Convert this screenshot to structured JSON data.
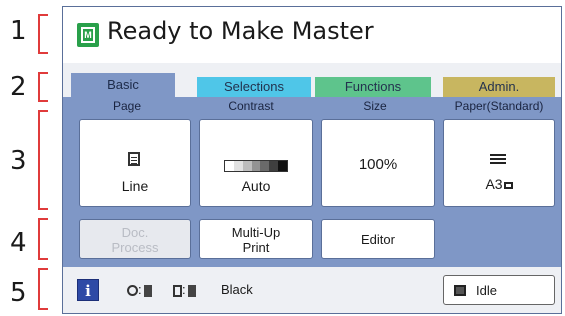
{
  "callouts": [
    "1",
    "2",
    "3",
    "4",
    "5"
  ],
  "title": {
    "icon": "master-document-icon",
    "icon_glyph": "M",
    "text": "Ready to Make Master"
  },
  "tabs": [
    {
      "label": "Basic",
      "color": "#7f97c6",
      "selected": true
    },
    {
      "label": "Selections",
      "color": "#4fc6e8"
    },
    {
      "label": "Functions",
      "color": "#5ec48c"
    },
    {
      "label": "Admin.",
      "color": "#c8b660"
    }
  ],
  "functions": [
    {
      "label": "Page",
      "value": "Line",
      "icon": "document-lines-icon"
    },
    {
      "label": "Contrast",
      "value": "Auto",
      "icon": "grayscale-bar-icon"
    },
    {
      "label": "Size",
      "value": "100%"
    },
    {
      "label": "Paper(Standard)",
      "value": "A3",
      "icon": "paper-stack-icon"
    }
  ],
  "secondary_buttons": [
    {
      "label_line1": "Doc.",
      "label_line2": "Process",
      "enabled": false
    },
    {
      "label_line1": "Multi-Up",
      "label_line2": "Print",
      "enabled": true
    },
    {
      "label": "Editor",
      "enabled": true
    }
  ],
  "status": {
    "info_label": "i",
    "drum_sep": ":",
    "ink_sep": ":",
    "ink_color": "Black",
    "idle_label": "Idle"
  },
  "colors": {
    "panel": "#7f97c6",
    "info": "#2e4aa6",
    "title_icon": "#29a04a",
    "callout_bracket": "#e03b3b"
  }
}
